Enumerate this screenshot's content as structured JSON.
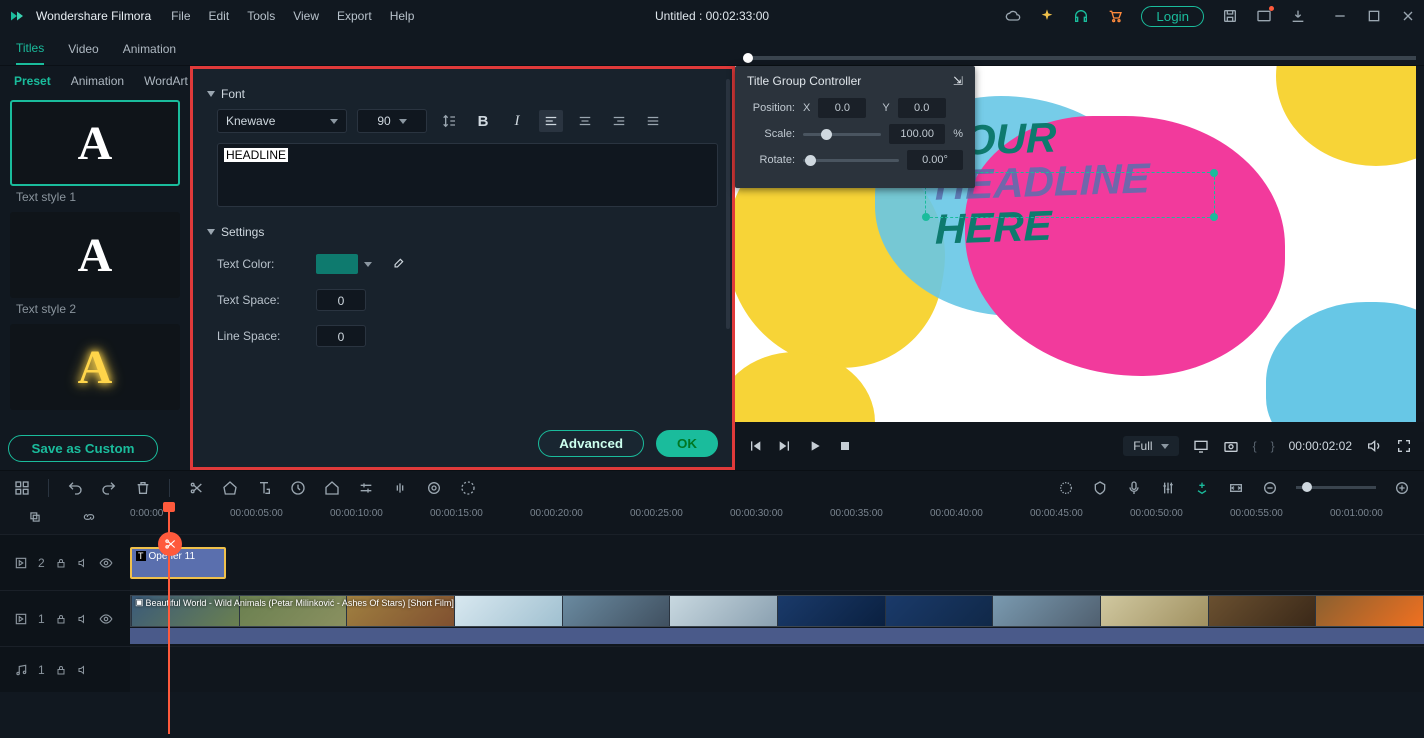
{
  "app": {
    "name": "Wondershare Filmora",
    "doc_title": "Untitled : 00:02:33:00",
    "login": "Login"
  },
  "menu": [
    "File",
    "Edit",
    "Tools",
    "View",
    "Export",
    "Help"
  ],
  "subtabs": {
    "items": [
      "Titles",
      "Video",
      "Animation"
    ],
    "active": "Titles"
  },
  "preset_tabs": {
    "items": [
      "Preset",
      "Animation",
      "WordArt"
    ],
    "active": "Preset"
  },
  "styles": {
    "s1": "Text style 1",
    "s2": "Text style 2"
  },
  "save_custom": "Save as Custom",
  "editor": {
    "font_section": "Font",
    "font_family": "Knewave",
    "font_size": "90",
    "text": "HEADLINE",
    "settings_section": "Settings",
    "text_color_label": "Text Color:",
    "text_space_label": "Text Space:",
    "text_space": "0",
    "line_space_label": "Line Space:",
    "line_space": "0",
    "advanced": "Advanced",
    "ok": "OK"
  },
  "tg_panel": {
    "title": "Title Group Controller",
    "position_label": "Position:",
    "x_label": "X",
    "x": "0.0",
    "y_label": "Y",
    "y": "0.0",
    "scale_label": "Scale:",
    "scale": "100.00",
    "scale_unit": "%",
    "rotate_label": "Rotate:",
    "rotate": "0.00°"
  },
  "preview": {
    "line1": "YOUR",
    "line2": "HEADLINE",
    "line3": "HERE",
    "timecode": "00:00:02:02",
    "quality": "Full"
  },
  "ruler": [
    "0:00:00",
    "00:00:05:00",
    "00:00:10:00",
    "00:00:15:00",
    "00:00:20:00",
    "00:00:25:00",
    "00:00:30:00",
    "00:00:35:00",
    "00:00:40:00",
    "00:00:45:00",
    "00:00:50:00",
    "00:00:55:00",
    "00:01:00:00"
  ],
  "tracks": {
    "t1": {
      "name": "2",
      "clip": "Opener 11"
    },
    "t2": {
      "name": "1",
      "clip": "Beautiful World - Wild Animals (Petar Milinković - Ashes Of Stars) [Short Film]"
    },
    "t3": {
      "name": "1"
    }
  }
}
